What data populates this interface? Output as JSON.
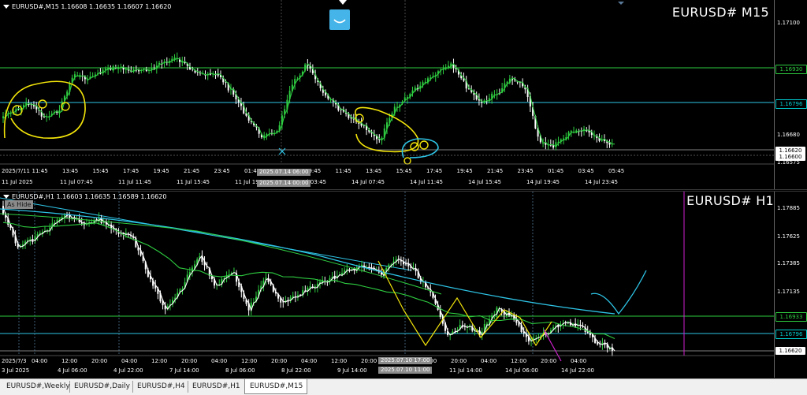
{
  "top_chart": {
    "title": "EURUSD# M15",
    "ohlc": "EURUSD#,M15  1.16608 1.16635 1.16607 1.16620",
    "price_ticks": [
      "1.17100",
      "1.16890",
      "1.16680",
      "1.16575"
    ],
    "price_labels": [
      {
        "text": "1.16930",
        "color": "#2ecc40"
      },
      {
        "text": "1.16796",
        "color": "#00ced1"
      },
      {
        "text": "1.16620",
        "color": "#ffffff"
      },
      {
        "text": "1.16600",
        "color": "#ffffff"
      }
    ],
    "time_labels": [
      "2025/7/11",
      "11:45",
      "13:45",
      "15:45",
      "17:45",
      "19:45",
      "21:45",
      "23:45",
      "01:45",
      "07:45",
      "09:45",
      "11:45",
      "13:45",
      "15:45",
      "17:45",
      "19:45",
      "21:45",
      "23:45",
      "01:45",
      "03:45",
      "05:45"
    ],
    "time_labels2": [
      "11 Jul 2025",
      "11 Jul 07:45",
      "11 Jul 11:45",
      "11 Jul 15:45",
      "11 Jul 19:45",
      "14 Jul 03:45",
      "14 Jul 07:45",
      "14 Jul 11:45",
      "14 Jul 15:45",
      "14 Jul 19:45",
      "14 Jul 23:45"
    ],
    "crosshair_time_1": "2025.07.14 06:00",
    "crosshair_time_2": "2025.07.14 00:00"
  },
  "bottom_chart": {
    "title": "EURUSD# H1",
    "ohlc": "EURUSD#,H1  1.16603 1.16635 1.16589 1.16620",
    "hide_button": "As Hide",
    "price_ticks": [
      "1.17885",
      "1.17625",
      "1.17385",
      "1.17135",
      "1.16883"
    ],
    "price_labels": [
      {
        "text": "1.16933",
        "color": "#2ecc40"
      },
      {
        "text": "1.16796",
        "color": "#00ced1"
      },
      {
        "text": "1.16620",
        "color": "#ffffff"
      }
    ],
    "time_labels": [
      "2025/7/3",
      "04:00",
      "12:00",
      "20:00",
      "04:00",
      "12:00",
      "20:00",
      "04:00",
      "12:00",
      "20:00",
      "04:00",
      "12:00",
      "20:00",
      "04:00",
      "12:00",
      "20:00",
      "04:00",
      "12:00",
      "20:00",
      "04:00"
    ],
    "time_labels2": [
      "3 Jul 2025",
      "4 Jul 06:00",
      "4 Jul 22:00",
      "7 Jul 14:00",
      "8 Jul 06:00",
      "8 Jul 22:00",
      "9 Jul 14:00",
      "10 Jul 22:00",
      "11 Jul 14:00",
      "14 Jul 06:00",
      "14 Jul 22:00"
    ],
    "crosshair_time_1": "2025.07.10 17:00",
    "crosshair_time_2": "2025.07.10 11:00"
  },
  "tabs": [
    {
      "label": "EURUSD#,Weekly",
      "active": false
    },
    {
      "label": "EURUSD#,Daily",
      "active": false
    },
    {
      "label": "EURUSD#,H4",
      "active": false
    },
    {
      "label": "EURUSD#,H1",
      "active": false
    },
    {
      "label": "EURUSD#,M15",
      "active": true
    }
  ],
  "colors": {
    "bull": "#2ecc40",
    "bear": "#ffffff",
    "ma_green": "#2ecc40",
    "ma_cyan": "#2ec4e6",
    "ma_white": "#ffffff",
    "annotation_yellow": "#f2e40a",
    "annotation_cyan": "#2ec4e6",
    "magenta": "#d020d0"
  }
}
